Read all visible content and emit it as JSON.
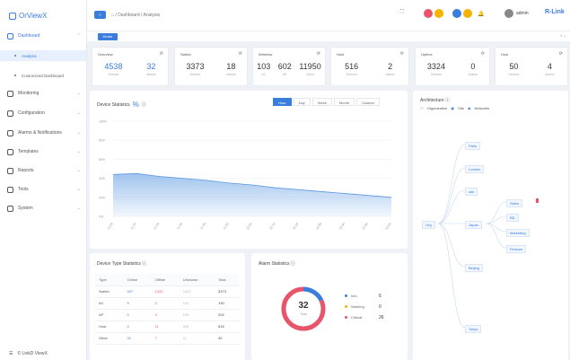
{
  "app": {
    "name": "OrViewX"
  },
  "sidebar": {
    "items": [
      {
        "label": "Dashboard",
        "top": 34,
        "open": true
      },
      {
        "label": "Monitoring",
        "top": 98
      },
      {
        "label": "Configuration",
        "top": 120
      },
      {
        "label": "Alarms & Notifications",
        "top": 142
      },
      {
        "label": "Templates",
        "top": 163
      },
      {
        "label": "Reports",
        "top": 184
      },
      {
        "label": "Tools",
        "top": 205
      },
      {
        "label": "System",
        "top": 226
      }
    ],
    "sub": [
      {
        "label": "Analysis",
        "active": true
      },
      {
        "label": "Customized Dashboard"
      }
    ],
    "footer": "© LinkD ViewX"
  },
  "topbar": {
    "menu_label": "≡",
    "breadcrumb": "⌂ / Dashboard / Analysis",
    "user": "admin",
    "brand": "R-Link"
  },
  "tabs": {
    "home": "Home"
  },
  "stats": [
    {
      "title": "Overview",
      "values": [
        {
          "n": "4538",
          "l": "Devices",
          "blue": true
        },
        {
          "n": "32",
          "l": "Alarms",
          "blue": true
        }
      ]
    },
    {
      "title": "Switch",
      "values": [
        {
          "n": "3373",
          "l": "Devices"
        },
        {
          "n": "18",
          "l": "Alarms"
        }
      ]
    },
    {
      "title": "Wireless",
      "values": [
        {
          "n": "103",
          "l": "AC"
        },
        {
          "n": "602",
          "l": "AP"
        },
        {
          "n": "11950",
          "l": "Client"
        }
      ]
    },
    {
      "title": "Host",
      "values": [
        {
          "n": "516",
          "l": "Devices"
        },
        {
          "n": "2",
          "l": "Alarms"
        }
      ]
    },
    {
      "title": "Uptime",
      "values": [
        {
          "n": "3324",
          "l": "Devices"
        },
        {
          "n": "0",
          "l": "Alarms"
        }
      ]
    },
    {
      "title": "Host",
      "values": [
        {
          "n": "50",
          "l": "Devices"
        },
        {
          "n": "4",
          "l": "Alarms"
        }
      ]
    }
  ],
  "device_stats": {
    "title": "Device Statistics",
    "pct_icon": "%",
    "periods": [
      "Hour",
      "Day",
      "Week",
      "Month",
      "Custom"
    ],
    "active_period": 0
  },
  "chart_data": {
    "type": "area",
    "title": "Device Statistics",
    "ylim": [
      0,
      100
    ],
    "yticks": [
      "100%",
      "80%",
      "60%",
      "40%",
      "20%",
      "0%"
    ],
    "x": [
      "11:00",
      "11:10",
      "11:20",
      "11:30",
      "11:40",
      "11:50",
      "12:00",
      "12:10",
      "12:20",
      "12:30",
      "12:40",
      "12:50",
      "13:00"
    ],
    "series": [
      {
        "values": [
          44,
          45,
          42,
          40,
          38,
          35,
          33,
          30,
          28,
          26,
          24,
          22,
          20
        ]
      }
    ],
    "color": "#7fb0e8"
  },
  "device_type": {
    "title": "Device Type Statistics",
    "headers": [
      "Type",
      "Online",
      "Offline",
      "Unknown",
      "Total"
    ],
    "rows": [
      [
        "Switch",
        "407",
        "1332",
        "1634",
        "3373"
      ],
      [
        "AC",
        "5",
        "2",
        "123",
        "130"
      ],
      [
        "AP",
        "0",
        "3",
        "199",
        "202"
      ],
      [
        "Host",
        "0",
        "11",
        "505",
        "516"
      ],
      [
        "Other",
        "31",
        "7",
        "11",
        "49"
      ]
    ]
  },
  "alarms": {
    "title": "Alarm Statistics",
    "total": "32",
    "total_label": "Total",
    "legend": [
      {
        "label": "Info",
        "value": "6",
        "color": "#3b7ddd"
      },
      {
        "label": "Warning",
        "value": "0",
        "color": "#f5b400"
      },
      {
        "label": "Critical",
        "value": "26",
        "color": "#e8556a"
      }
    ],
    "fractions": [
      0.18,
      0.0,
      0.82
    ]
  },
  "arch": {
    "title": "Architecture",
    "legend": [
      "Organization",
      "Site",
      "Networks"
    ],
    "root": "Org",
    "children": [
      "Paris",
      "London",
      "site",
      "Japan",
      "Beijing",
      "Tokyo"
    ],
    "japan_children": [
      "Sales",
      "BD",
      "Marketing",
      "Finance"
    ]
  },
  "colors": {
    "accent": "#3b7ddd",
    "danger": "#e8556a",
    "warn": "#f5b400"
  }
}
